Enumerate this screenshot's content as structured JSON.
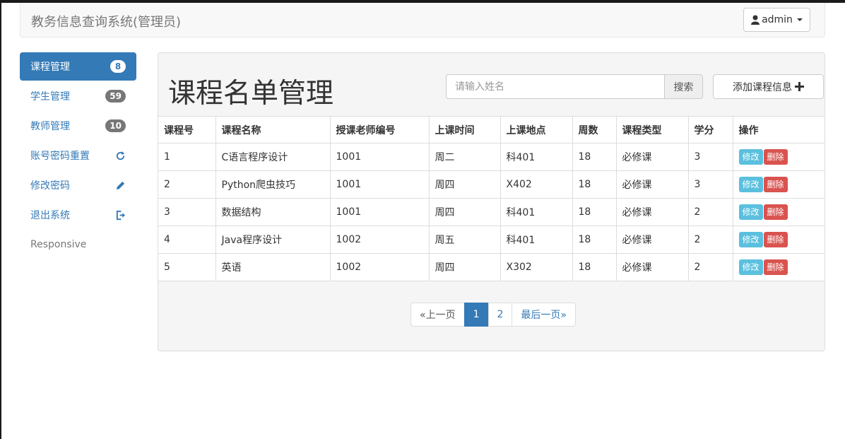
{
  "navbar": {
    "brand": "教务信息查询系统(管理员)",
    "user_label": "admin"
  },
  "sidebar": {
    "items": [
      {
        "label": "课程管理",
        "badge": "8"
      },
      {
        "label": "学生管理",
        "badge": "59"
      },
      {
        "label": "教师管理",
        "badge": "10"
      },
      {
        "label": "账号密码重置",
        "icon": "refresh-icon"
      },
      {
        "label": "修改密码",
        "icon": "pencil-icon"
      },
      {
        "label": "退出系统",
        "icon": "logout-icon"
      },
      {
        "label": "Responsive"
      }
    ]
  },
  "main": {
    "title": "课程名单管理",
    "search": {
      "placeholder": "请输入姓名",
      "button_label": "搜索"
    },
    "add_button_label": "添加课程信息"
  },
  "table": {
    "columns": [
      "课程号",
      "课程名称",
      "授课老师编号",
      "上课时间",
      "上课地点",
      "周数",
      "课程类型",
      "学分",
      "操作"
    ],
    "rows": [
      [
        "1",
        "C语言程序设计",
        "1001",
        "周二",
        "科401",
        "18",
        "必修课",
        "3"
      ],
      [
        "2",
        "Python爬虫技巧",
        "1001",
        "周四",
        "X402",
        "18",
        "必修课",
        "3"
      ],
      [
        "3",
        "数据结构",
        "1001",
        "周四",
        "科401",
        "18",
        "必修课",
        "2"
      ],
      [
        "4",
        "Java程序设计",
        "1002",
        "周五",
        "科401",
        "18",
        "必修课",
        "2"
      ],
      [
        "5",
        "英语",
        "1002",
        "周四",
        "X302",
        "18",
        "必修课",
        "2"
      ]
    ],
    "edit_label": "修改",
    "delete_label": "删除"
  },
  "pagination": {
    "prev": "«上一页",
    "pages": [
      "1",
      "2"
    ],
    "current": "1",
    "last": "最后一页»"
  },
  "colors": {
    "primary": "#337ab7",
    "info": "#5bc0de",
    "danger": "#d9534f"
  }
}
